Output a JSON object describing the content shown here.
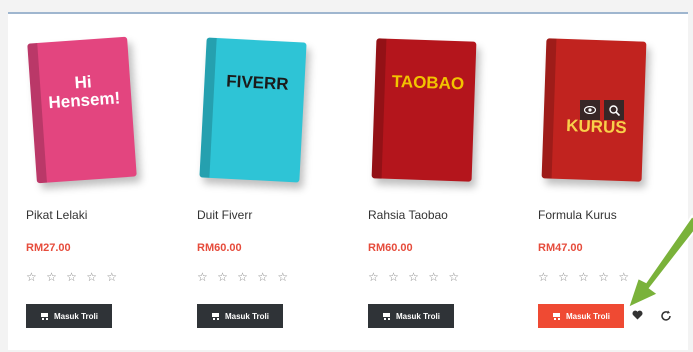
{
  "products": [
    {
      "name": "Pikat Lelaki",
      "price": "RM27.00",
      "stars": "☆ ☆ ☆ ☆ ☆",
      "button": "Masuk Troli",
      "cover": {
        "title": "Hi Hensem!",
        "bg": "#e3457f",
        "fg": "#ffffff"
      }
    },
    {
      "name": "Duit Fiverr",
      "price": "RM60.00",
      "stars": "☆ ☆ ☆ ☆ ☆",
      "button": "Masuk Troli",
      "cover": {
        "title": "FIVERR",
        "bg": "#2ec4d6",
        "fg": "#1b1b1b"
      }
    },
    {
      "name": "Rahsia Taobao",
      "price": "RM60.00",
      "stars": "☆ ☆ ☆ ☆ ☆",
      "button": "Masuk Troli",
      "cover": {
        "title": "TAOBAO",
        "bg": "#b4151c",
        "fg": "#f2c300"
      }
    },
    {
      "name": "Formula Kurus",
      "price": "RM47.00",
      "stars": "☆ ☆ ☆ ☆ ☆",
      "button": "Masuk Troli",
      "cover": {
        "title": "KURUS",
        "bg": "#c1231f",
        "fg": "#f8d04a"
      }
    }
  ],
  "icons": {
    "quick_view": "eye-icon",
    "zoom": "zoom-icon",
    "wishlist": "heart-icon",
    "compare": "refresh-icon"
  },
  "colors": {
    "price": "#e64c3c",
    "button": "#2f3337",
    "button_active": "#ef4a33",
    "arrow": "#7ab23a"
  }
}
